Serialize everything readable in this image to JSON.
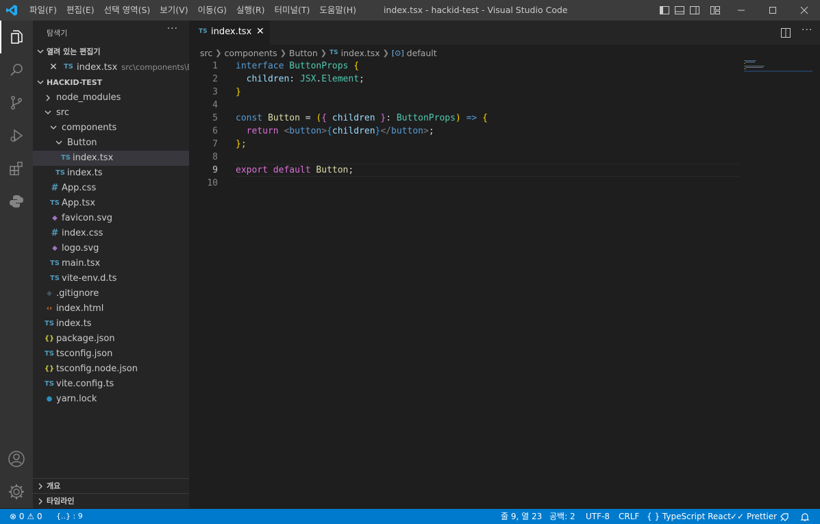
{
  "menu": [
    "파일(F)",
    "편집(E)",
    "선택 영역(S)",
    "보기(V)",
    "이동(G)",
    "실행(R)",
    "터미널(T)",
    "도움말(H)"
  ],
  "window_title": "index.tsx - hackid-test - Visual Studio Code",
  "sidebar": {
    "title": "탐색기",
    "more": "···",
    "open_editors_label": "열려 있는 편집기",
    "open_editor": {
      "name": "index.tsx",
      "path": "src\\components\\B...",
      "icon": "TS"
    },
    "project_label": "HACKID-TEST",
    "tree": [
      {
        "name": "node_modules",
        "kind": "folder",
        "icon": "chevron-right"
      },
      {
        "name": "src",
        "kind": "folder",
        "icon": "chevron-down"
      },
      {
        "name": "components",
        "kind": "folder",
        "icon": "chevron-down"
      },
      {
        "name": "Button",
        "kind": "folder",
        "icon": "chevron-down"
      },
      {
        "name": "index.tsx",
        "kind": "file",
        "icon": "TS"
      },
      {
        "name": "index.ts",
        "kind": "file",
        "icon": "TS"
      },
      {
        "name": "App.css",
        "kind": "file",
        "icon": "#"
      },
      {
        "name": "App.tsx",
        "kind": "file",
        "icon": "TS"
      },
      {
        "name": "favicon.svg",
        "kind": "file",
        "icon": "svg"
      },
      {
        "name": "index.css",
        "kind": "file",
        "icon": "#"
      },
      {
        "name": "logo.svg",
        "kind": "file",
        "icon": "svg"
      },
      {
        "name": "main.tsx",
        "kind": "file",
        "icon": "TS"
      },
      {
        "name": "vite-env.d.ts",
        "kind": "file",
        "icon": "TS"
      },
      {
        "name": ".gitignore",
        "kind": "file",
        "icon": "git"
      },
      {
        "name": "index.html",
        "kind": "file",
        "icon": "<>"
      },
      {
        "name": "index.ts",
        "kind": "file",
        "icon": "TS"
      },
      {
        "name": "package.json",
        "kind": "file",
        "icon": "{}"
      },
      {
        "name": "tsconfig.json",
        "kind": "file",
        "icon": "TS"
      },
      {
        "name": "tsconfig.node.json",
        "kind": "file",
        "icon": "{}"
      },
      {
        "name": "vite.config.ts",
        "kind": "file",
        "icon": "TS"
      },
      {
        "name": "yarn.lock",
        "kind": "file",
        "icon": "yarn"
      }
    ],
    "outline_label": "개요",
    "timeline_label": "타임라인"
  },
  "editor": {
    "tab_label": "index.tsx",
    "tab_icon": "TS",
    "breadcrumb": [
      "src",
      "components",
      "Button",
      "index.tsx",
      "default"
    ],
    "line_numbers": [
      "1",
      "2",
      "3",
      "4",
      "5",
      "6",
      "7",
      "8",
      "9",
      "10"
    ],
    "current_line": "9",
    "code": {
      "l1_kw": "interface",
      "l1_name": "ButtonProps",
      "l1_brace": "{",
      "l2_prop": "children",
      "l2_colon": ":",
      "l2_type": "JSX",
      "l2_dot": ".",
      "l2_type2": "Element",
      "l2_semi": ";",
      "l3": "}",
      "l5_kw": "const",
      "l5_name": "Button",
      "l5_eq": "=",
      "l5_p1": "(",
      "l5_b1": "{",
      "l5_param": "children",
      "l5_b2": "}",
      "l5_colon": ":",
      "l5_type": "ButtonProps",
      "l5_p2": ")",
      "l5_arrow": "=>",
      "l5_b3": "{",
      "l6_kw": "return",
      "l6_open": "<",
      "l6_tag": "button",
      "l6_gt": ">",
      "l6_b1": "{",
      "l6_var": "children",
      "l6_b2": "}",
      "l6_close": "</",
      "l6_tag2": "button",
      "l6_gt2": ">",
      "l6_semi": ";",
      "l7": "};",
      "l9_kw1": "export",
      "l9_kw2": "default",
      "l9_name": "Button",
      "l9_semi": ";"
    }
  },
  "statusbar": {
    "errors": "0",
    "warnings": "0",
    "bracket": "{..} : 9",
    "position": "줄 9, 열 23",
    "spaces": "공백: 2",
    "encoding": "UTF-8",
    "eol": "CRLF",
    "language": "TypeScript React",
    "formatter": "Prettier"
  },
  "colors": {
    "accent": "#007acc",
    "titlebar": "#3c3c3c",
    "sidebar": "#252526",
    "editor": "#1e1e1e"
  }
}
